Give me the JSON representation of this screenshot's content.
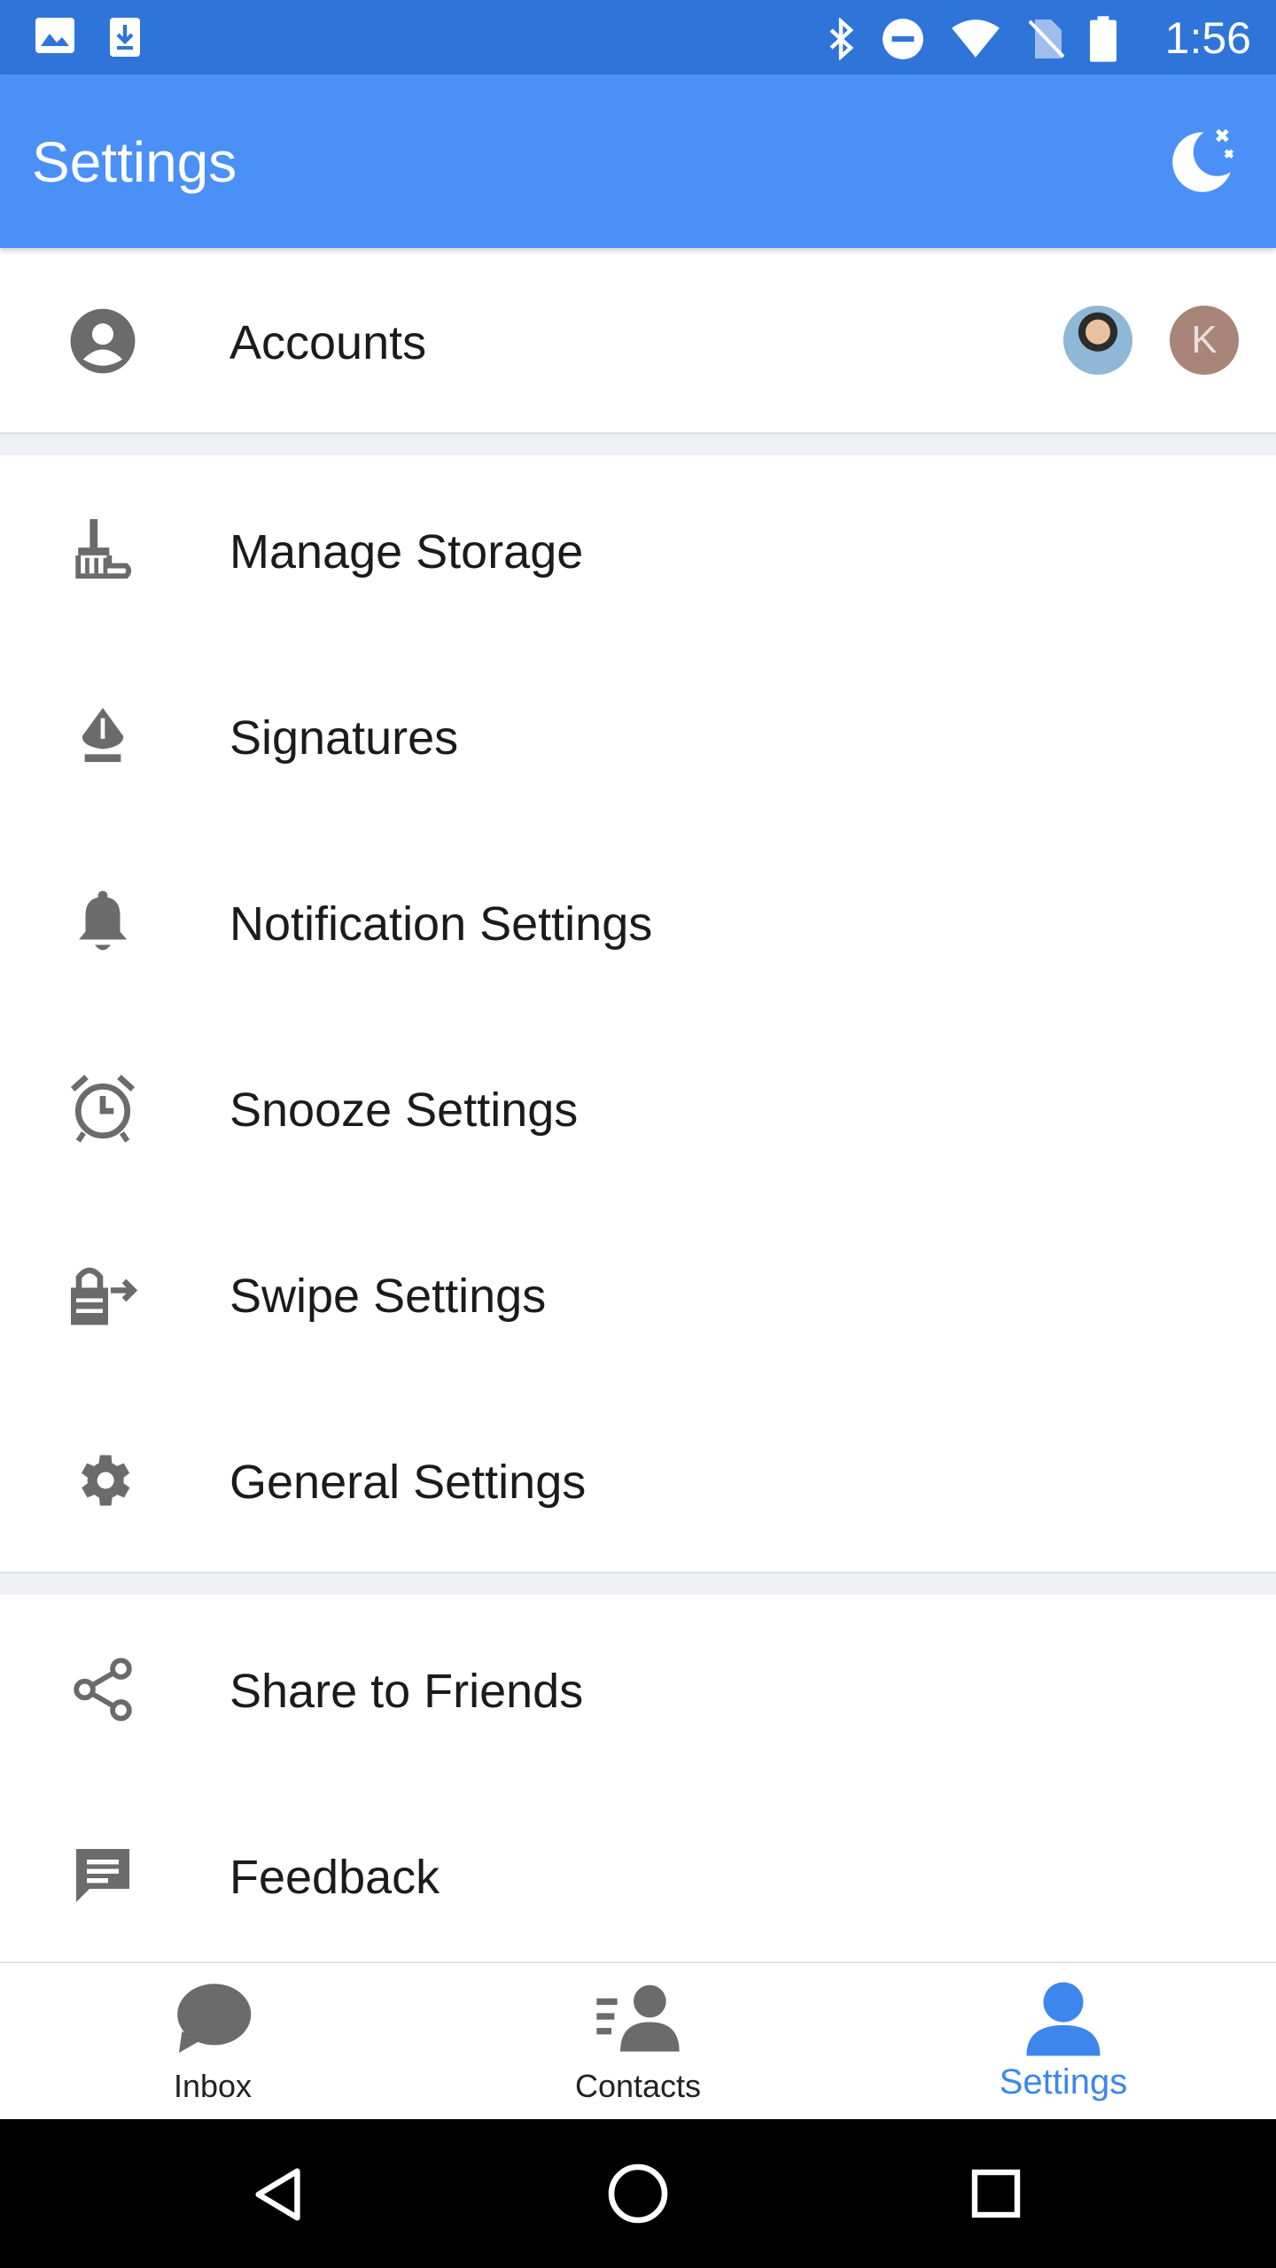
{
  "status_bar": {
    "time": "1:56",
    "left_icons": [
      "image-icon",
      "download-icon"
    ],
    "right_icons": [
      "bluetooth-icon",
      "do-not-disturb-icon",
      "wifi-icon",
      "no-sim-icon",
      "battery-icon"
    ]
  },
  "app_bar": {
    "title": "Settings",
    "action_icon": "night-mode-icon"
  },
  "accounts": {
    "label": "Accounts",
    "avatar_initial": "K"
  },
  "menu": {
    "manage_storage": "Manage Storage",
    "signatures": "Signatures",
    "notification_settings": "Notification Settings",
    "snooze_settings": "Snooze Settings",
    "swipe_settings": "Swipe Settings",
    "general_settings": "General Settings",
    "share_to_friends": "Share to Friends",
    "feedback": "Feedback"
  },
  "bottom_nav": {
    "inbox": "Inbox",
    "contacts": "Contacts",
    "settings": "Settings",
    "active": "settings"
  },
  "colors": {
    "status_bar": "#2f74d9",
    "app_bar": "#4a90f7",
    "accent": "#3d86ee",
    "icon_grey": "#6b6b6b",
    "avatar_k": "#a88479"
  }
}
